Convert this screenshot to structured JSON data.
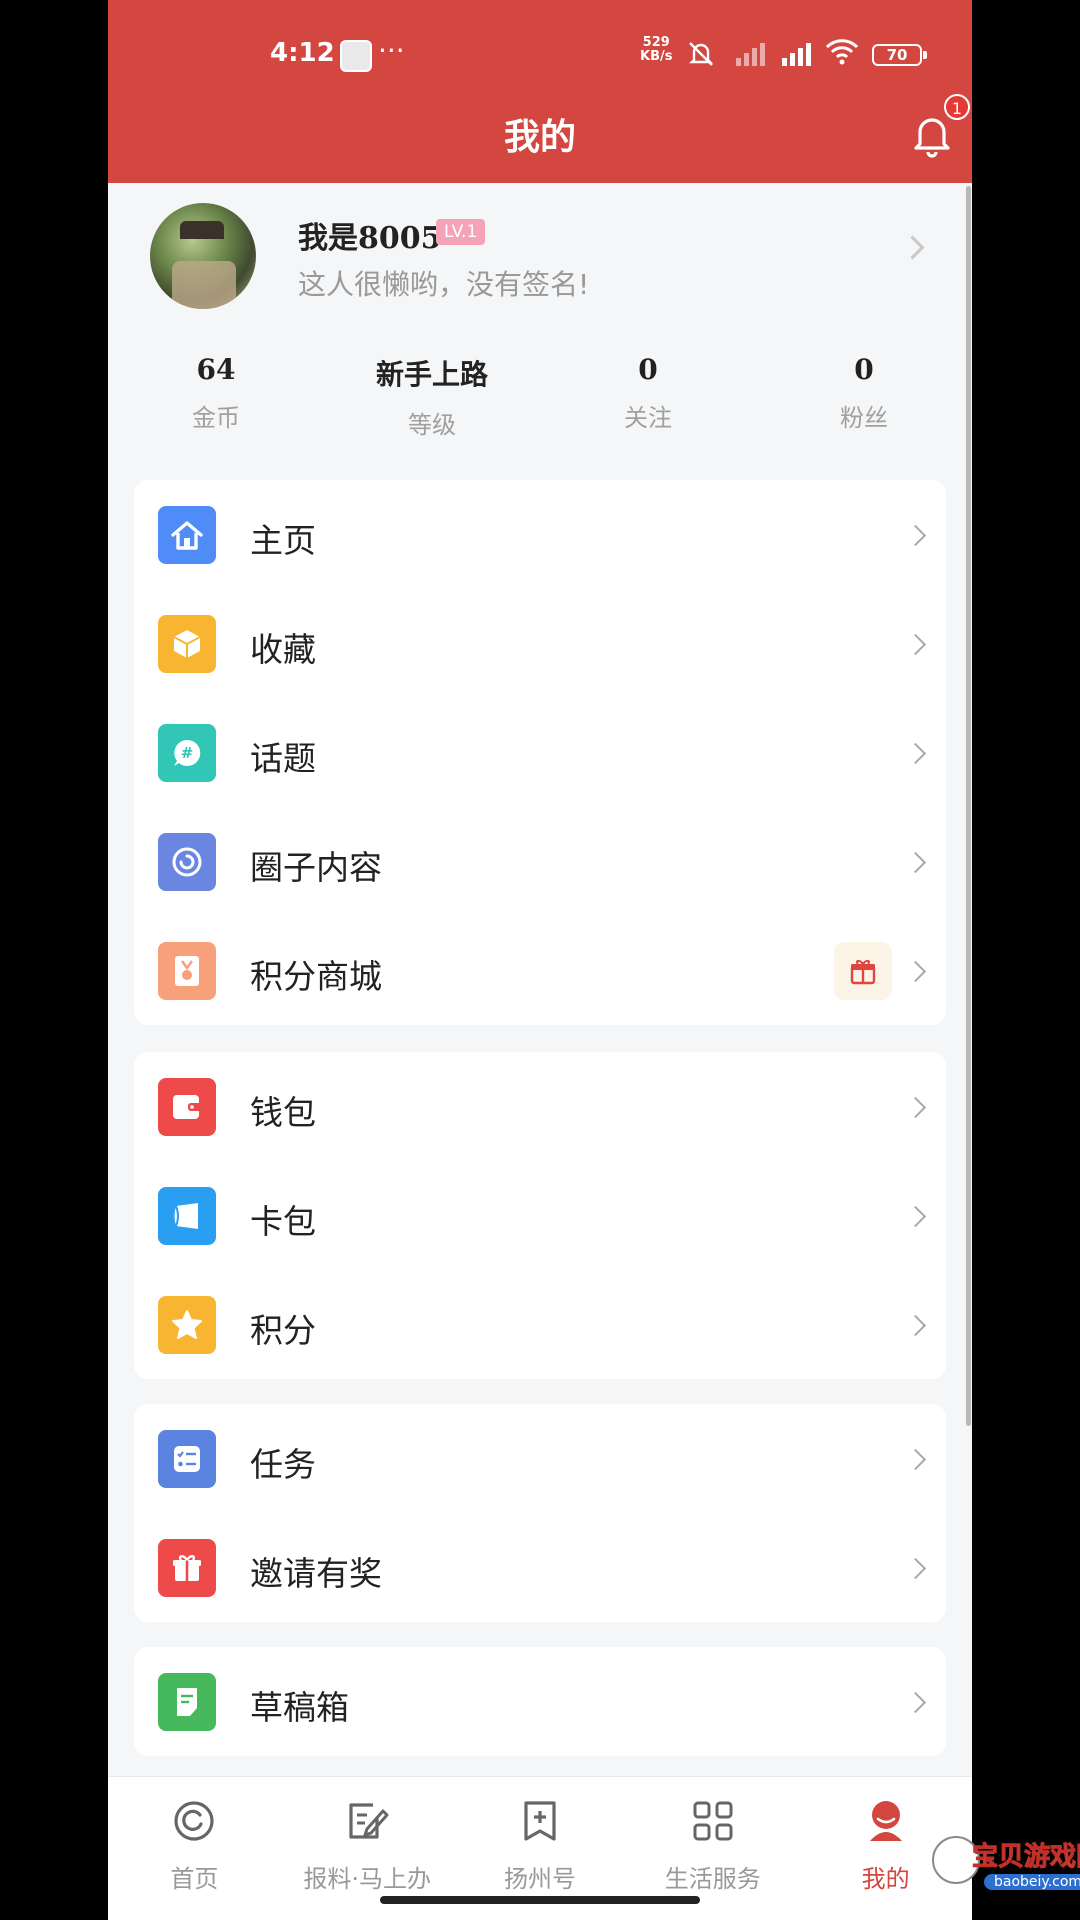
{
  "status_bar": {
    "time": "4:12",
    "dots": "···",
    "net_speed": "529",
    "net_unit": "KB/s",
    "battery": "70"
  },
  "header": {
    "title": "我的",
    "notification_count": "1"
  },
  "profile": {
    "username": "我是8005",
    "level_badge": "LV.1",
    "signature": "这人很懒哟，没有签名!"
  },
  "stats": [
    {
      "value": "64",
      "label": "金币"
    },
    {
      "value": "新手上路",
      "label": "等级"
    },
    {
      "value": "0",
      "label": "关注"
    },
    {
      "value": "0",
      "label": "粉丝"
    }
  ],
  "menu_group_1": [
    {
      "label": "主页",
      "icon": "home-icon",
      "color": "#4f8cf7"
    },
    {
      "label": "收藏",
      "icon": "cube-icon",
      "color": "#f7b531"
    },
    {
      "label": "话题",
      "icon": "topic-hash-icon",
      "color": "#31c6b5"
    },
    {
      "label": "圈子内容",
      "icon": "circle-swirl-icon",
      "color": "#6a86e0"
    },
    {
      "label": "积分商城",
      "icon": "medal-icon",
      "color": "#f7a07a"
    }
  ],
  "menu_group_2": [
    {
      "label": "钱包",
      "icon": "wallet-icon",
      "color": "#ee4a4a"
    },
    {
      "label": "卡包",
      "icon": "card-icon",
      "color": "#2a9ef0"
    },
    {
      "label": "积分",
      "icon": "star-icon",
      "color": "#f7b531"
    }
  ],
  "menu_group_3": [
    {
      "label": "任务",
      "icon": "task-list-icon",
      "color": "#5b84e0"
    },
    {
      "label": "邀请有奖",
      "icon": "gift-icon",
      "color": "#ee4a4a"
    }
  ],
  "menu_group_4": [
    {
      "label": "草稿箱",
      "icon": "draft-icon",
      "color": "#45b95b"
    }
  ],
  "bottom_nav": [
    {
      "label": "首页",
      "icon": "home-tab-icon"
    },
    {
      "label": "报料·马上办",
      "icon": "report-edit-icon"
    },
    {
      "label": "扬州号",
      "icon": "bookmark-plus-icon"
    },
    {
      "label": "生活服务",
      "icon": "grid-icon"
    },
    {
      "label": "我的",
      "icon": "profile-tab-icon",
      "active": true
    }
  ],
  "watermark": {
    "text": "宝贝游戏网",
    "url": "baobeiy.com"
  },
  "colors": {
    "brand_red": "#d44640",
    "background": "#f5f6f7"
  }
}
